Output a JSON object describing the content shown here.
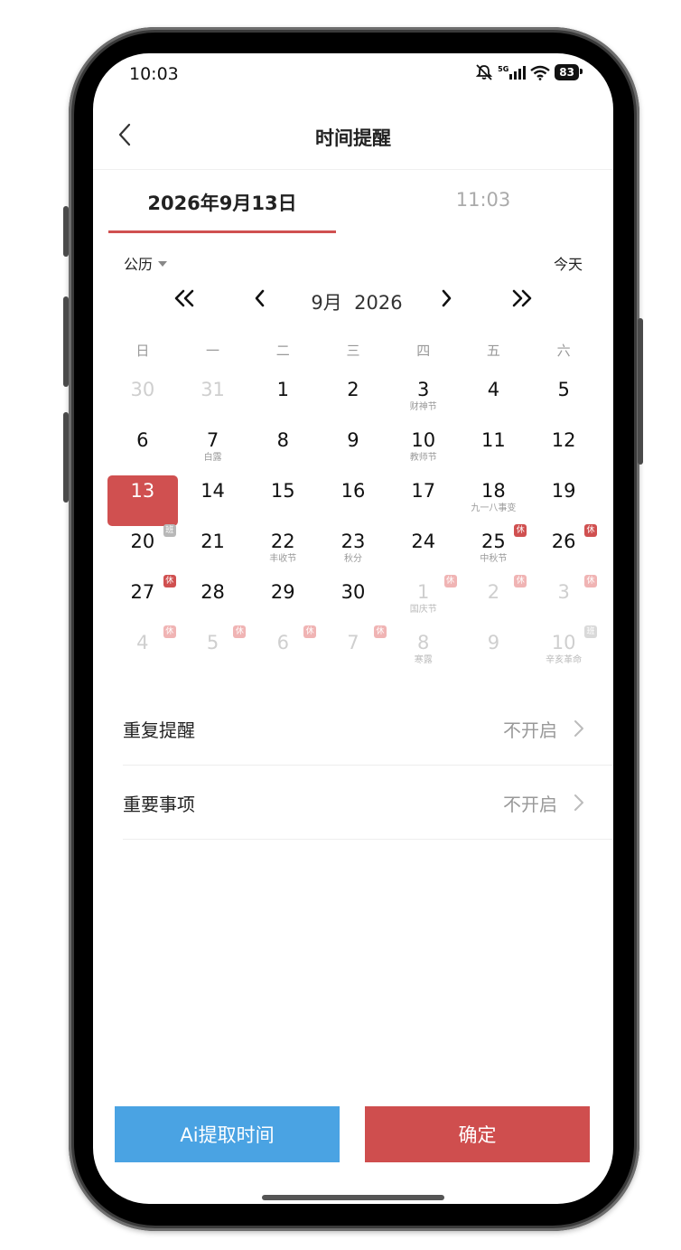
{
  "status_bar": {
    "time": "10:03",
    "network": "5G",
    "battery": "83"
  },
  "header": {
    "title": "时间提醒"
  },
  "tabs": {
    "date": "2026年9月13日",
    "time": "11:03"
  },
  "calendar": {
    "type_label": "公历",
    "today_label": "今天",
    "month_label": "9月  2026",
    "weekdays": [
      "日",
      "一",
      "二",
      "三",
      "四",
      "五",
      "六"
    ],
    "days": [
      {
        "day": "30",
        "other": true
      },
      {
        "day": "31",
        "other": true
      },
      {
        "day": "1"
      },
      {
        "day": "2"
      },
      {
        "day": "3",
        "sub": "财神节"
      },
      {
        "day": "4"
      },
      {
        "day": "5"
      },
      {
        "day": "6"
      },
      {
        "day": "7",
        "sub": "白露"
      },
      {
        "day": "8"
      },
      {
        "day": "9"
      },
      {
        "day": "10",
        "sub": "教师节"
      },
      {
        "day": "11"
      },
      {
        "day": "12"
      },
      {
        "day": "13",
        "selected": true
      },
      {
        "day": "14"
      },
      {
        "day": "15"
      },
      {
        "day": "16"
      },
      {
        "day": "17"
      },
      {
        "day": "18",
        "sub": "九一八事变"
      },
      {
        "day": "19"
      },
      {
        "day": "20",
        "badge": "班",
        "badge_type": "work"
      },
      {
        "day": "21"
      },
      {
        "day": "22",
        "sub": "丰收节"
      },
      {
        "day": "23",
        "sub": "秋分"
      },
      {
        "day": "24"
      },
      {
        "day": "25",
        "sub": "中秋节",
        "badge": "休",
        "badge_type": "rest"
      },
      {
        "day": "26",
        "badge": "休",
        "badge_type": "rest"
      },
      {
        "day": "27",
        "badge": "休",
        "badge_type": "rest"
      },
      {
        "day": "28"
      },
      {
        "day": "29"
      },
      {
        "day": "30"
      },
      {
        "day": "1",
        "other": true,
        "sub": "国庆节",
        "badge": "休",
        "badge_type": "rest"
      },
      {
        "day": "2",
        "other": true,
        "badge": "休",
        "badge_type": "rest"
      },
      {
        "day": "3",
        "other": true,
        "badge": "休",
        "badge_type": "rest"
      },
      {
        "day": "4",
        "other": true,
        "badge": "休",
        "badge_type": "rest"
      },
      {
        "day": "5",
        "other": true,
        "badge": "休",
        "badge_type": "rest"
      },
      {
        "day": "6",
        "other": true,
        "badge": "休",
        "badge_type": "rest"
      },
      {
        "day": "7",
        "other": true,
        "badge": "休",
        "badge_type": "rest"
      },
      {
        "day": "8",
        "other": true,
        "sub": "寒露"
      },
      {
        "day": "9",
        "other": true
      },
      {
        "day": "10",
        "other": true,
        "sub": "辛亥革命",
        "badge": "班",
        "badge_type": "work"
      }
    ]
  },
  "settings": [
    {
      "label": "重复提醒",
      "value": "不开启"
    },
    {
      "label": "重要事项",
      "value": "不开启"
    }
  ],
  "buttons": {
    "ai": "Ai提取时间",
    "confirm": "确定"
  },
  "colors": {
    "accent": "#d05050",
    "ai_button": "#4aa3e3",
    "confirm_button": "#cf4e4e"
  }
}
